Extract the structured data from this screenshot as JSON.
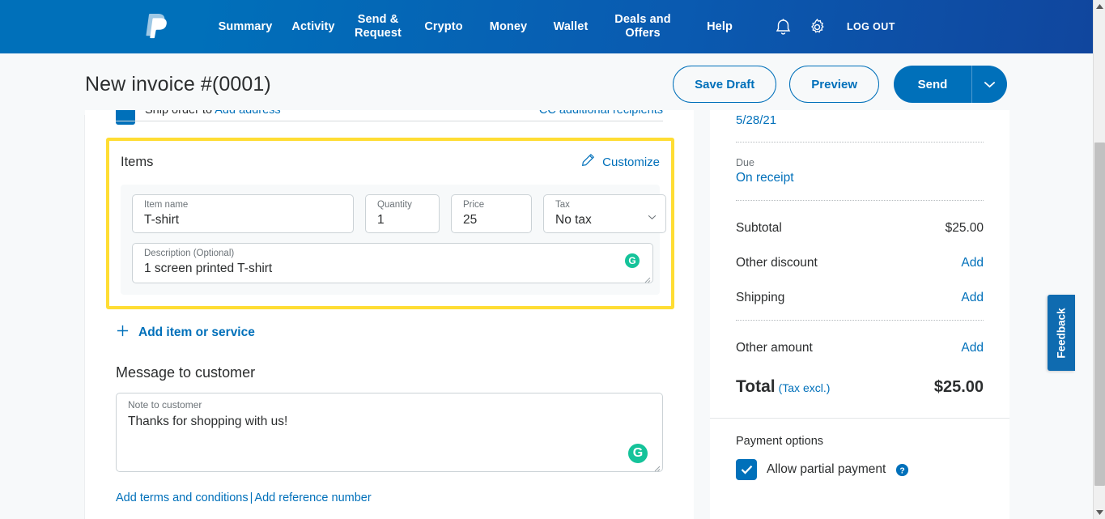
{
  "nav": {
    "logo": "paypal-logo",
    "links": [
      {
        "label": "Summary"
      },
      {
        "label": "Activity"
      },
      {
        "label": "Send &\nRequest"
      },
      {
        "label": "Crypto"
      },
      {
        "label": "Money"
      },
      {
        "label": "Wallet"
      },
      {
        "label": "Deals and\nOffers"
      },
      {
        "label": "Help"
      }
    ],
    "bell_icon": "bell-icon",
    "gear_icon": "gear-icon",
    "logout_label": "LOG OUT",
    "bg_color": "#0070ba"
  },
  "header": {
    "title": "New invoice #(0001)",
    "save_draft_label": "Save Draft",
    "preview_label": "Preview",
    "send_label": "Send",
    "send_caret_icon": "chevron-down-icon",
    "accent_color": "#0070ba"
  },
  "cut_row": {
    "text_prefix": "Ship order to ",
    "link_label": "Add address",
    "right_label": "CC additional recipients"
  },
  "items": {
    "title": "Items",
    "customize_label": "Customize",
    "customize_icon": "pencil-icon",
    "highlight_color": "#ffdd33",
    "fields": {
      "item_name": {
        "label": "Item name",
        "value": "T-shirt"
      },
      "quantity": {
        "label": "Quantity",
        "value": "1"
      },
      "price": {
        "label": "Price",
        "value": "25"
      },
      "tax": {
        "label": "Tax",
        "value": "No tax"
      },
      "description": {
        "label": "Description (Optional)",
        "value": "1 screen printed T-shirt"
      }
    },
    "grammarly_icon": "grammarly-icon",
    "add_item_label": "Add item or service",
    "add_item_icon": "plus-icon"
  },
  "message": {
    "title": "Message to customer",
    "note_label": "Note to customer",
    "note_value": "Thanks for shopping with us!",
    "grammarly_icon": "grammarly-icon"
  },
  "footer": {
    "terms_label": "Add terms and conditions",
    "separator": "|",
    "reference_label": "Add reference number"
  },
  "sidebar": {
    "date": "5/28/21",
    "due_label": "Due",
    "due_value": "On receipt",
    "rows": [
      {
        "label": "Subtotal",
        "value": "$25.00",
        "is_link": false
      },
      {
        "label": "Other discount",
        "value": "Add",
        "is_link": true
      },
      {
        "label": "Shipping",
        "value": "Add",
        "is_link": true
      },
      {
        "label": "Other amount",
        "value": "Add",
        "is_link": true
      }
    ],
    "total_label": "Total",
    "total_sub": "(Tax excl.)",
    "total_value": "$25.00",
    "payment_options_title": "Payment options",
    "allow_partial_label": "Allow partial payment",
    "help_icon": "question-mark-icon",
    "checkbox_checked": true
  },
  "feedback": {
    "label": "Feedback"
  },
  "scrollbar": {
    "up_icon": "triangle-up-icon",
    "down_icon": "triangle-down-icon"
  }
}
